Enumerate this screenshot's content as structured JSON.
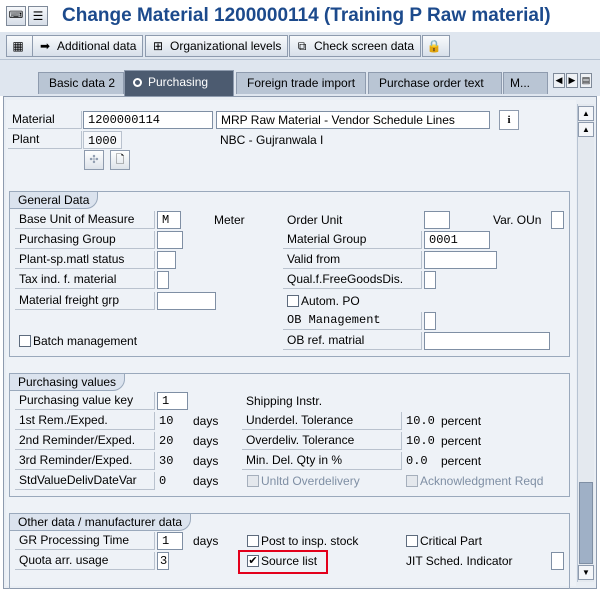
{
  "window": {
    "title": "Change Material 1200000114 (Training P Raw material)"
  },
  "app_toolbar": {
    "additional_data": "Additional data",
    "org_levels": "Organizational levels",
    "check_screen_data": "Check screen data"
  },
  "tabs": [
    {
      "label": "Basic data 2",
      "active": false
    },
    {
      "label": "Purchasing",
      "active": true
    },
    {
      "label": "Foreign trade import",
      "active": false
    },
    {
      "label": "Purchase order text",
      "active": false
    },
    {
      "label": "M...",
      "active": false
    }
  ],
  "header": {
    "material_label": "Material",
    "material_value": "1200000114",
    "material_desc": "MRP Raw Material - Vendor Schedule Lines",
    "plant_label": "Plant",
    "plant_value": "1000",
    "plant_desc": "NBC - Gujranwala I"
  },
  "general_data": {
    "title": "General Data",
    "base_uom_label": "Base Unit of Measure",
    "base_uom_value": "M",
    "base_uom_text": "Meter",
    "order_unit_label": "Order Unit",
    "order_unit_value": "",
    "var_oun_label": "Var. OUn",
    "purch_group_label": "Purchasing Group",
    "purch_group_value": "",
    "mat_group_label": "Material Group",
    "mat_group_value": "0001",
    "plant_status_label": "Plant-sp.matl status",
    "valid_from_label": "Valid from",
    "valid_from_value": "",
    "tax_ind_label": "Tax ind. f. material",
    "qual_free_label": "Qual.f.FreeGoodsDis.",
    "freight_grp_label": "Material freight grp",
    "autom_po_label": "Autom. PO",
    "autom_po_checked": false,
    "ob_mgmt_label": "OB Management",
    "batch_mgmt_label": "Batch management",
    "batch_mgmt_checked": false,
    "ob_ref_label": "OB ref. matrial",
    "ob_ref_value": ""
  },
  "purchasing_values": {
    "title": "Purchasing values",
    "pv_key_label": "Purchasing value key",
    "pv_key_value": "1",
    "shipping_label": "Shipping Instr.",
    "rem1_label": "1st Rem./Exped.",
    "rem1_value": "10",
    "rem1_unit": "days",
    "underdel_label": "Underdel. Tolerance",
    "underdel_value": "10.0",
    "underdel_unit": "percent",
    "rem2_label": "2nd Reminder/Exped.",
    "rem2_value": "20",
    "rem2_unit": "days",
    "overdel_label": "Overdeliv. Tolerance",
    "overdel_value": "10.0",
    "overdel_unit": "percent",
    "rem3_label": "3rd Reminder/Exped.",
    "rem3_value": "30",
    "rem3_unit": "days",
    "min_del_label": "Min. Del. Qty in %",
    "min_del_value": "0.0",
    "min_del_unit": "percent",
    "std_var_label": "StdValueDelivDateVar",
    "std_var_value": "0",
    "std_var_unit": "days",
    "unltd_label": "Unltd Overdelivery",
    "ack_label": "Acknowledgment Reqd"
  },
  "other_data": {
    "title": "Other data / manufacturer data",
    "gr_time_label": "GR Processing Time",
    "gr_time_value": "1",
    "gr_time_unit": "days",
    "post_insp_label": "Post to insp. stock",
    "post_insp_checked": false,
    "critical_label": "Critical Part",
    "critical_checked": false,
    "quota_label": "Quota arr. usage",
    "quota_value": "3",
    "source_list_label": "Source list",
    "source_list_checked": true,
    "jit_label": "JIT Sched. Indicator"
  },
  "colors": {
    "title": "#1c4a8c",
    "highlight": "#e3001b",
    "active_tab": "#4c5b70"
  },
  "icons": [
    "command-field-icon",
    "menu-icon",
    "overview-icon",
    "additional-data-icon",
    "org-levels-icon",
    "check-screen-icon",
    "lock-icon",
    "info-icon",
    "picture-icon",
    "document-icon"
  ]
}
